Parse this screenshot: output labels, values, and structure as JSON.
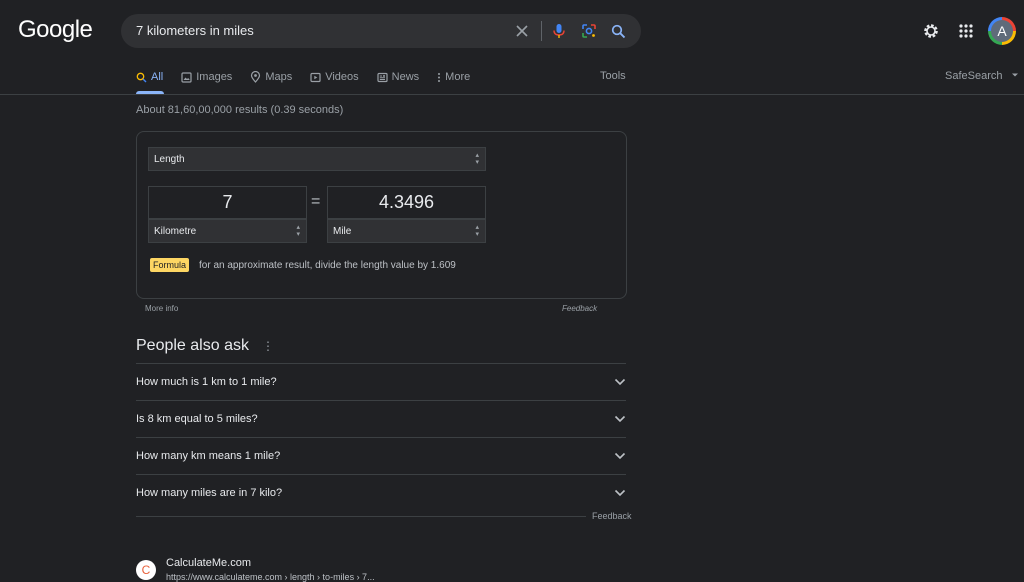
{
  "header": {
    "logo": "Google",
    "search": {
      "query": "7 kilometers in miles"
    }
  },
  "avatar": {
    "letter": "A"
  },
  "tabs": [
    {
      "label": "All",
      "icon": "search-icon",
      "active": true
    },
    {
      "label": "Images",
      "icon": "image-icon"
    },
    {
      "label": "Maps",
      "icon": "map-pin-icon"
    },
    {
      "label": "Videos",
      "icon": "video-icon"
    },
    {
      "label": "News",
      "icon": "news-icon"
    },
    {
      "label": "More",
      "icon": "more-vert-icon"
    }
  ],
  "tools_label": "Tools",
  "safesearch_label": "SafeSearch",
  "results_count": "About 81,60,00,000 results (0.39 seconds)",
  "converter": {
    "category": "Length",
    "from_value": "7",
    "from_unit": "Kilometre",
    "equals": "=",
    "to_value": "4.3496",
    "to_unit": "Mile",
    "formula_badge": "Formula",
    "formula_text": "for an approximate result, divide the length value by 1.609",
    "more_info": "More info",
    "feedback": "Feedback"
  },
  "paa": {
    "title": "People also ask",
    "questions": [
      "How much is 1 km to 1 mile?",
      "Is 8 km equal to 5 miles?",
      "How many km means 1 mile?",
      "How many miles are in 7 kilo?"
    ],
    "feedback": "Feedback"
  },
  "result": {
    "favicon_letter": "C",
    "site_name": "CalculateMe.com",
    "url": "https://www.calculateme.com › length › to-miles › 7..."
  },
  "colors": {
    "accent": "#8ab4f8",
    "background": "#202124",
    "formula_badge": "#fdd663"
  }
}
